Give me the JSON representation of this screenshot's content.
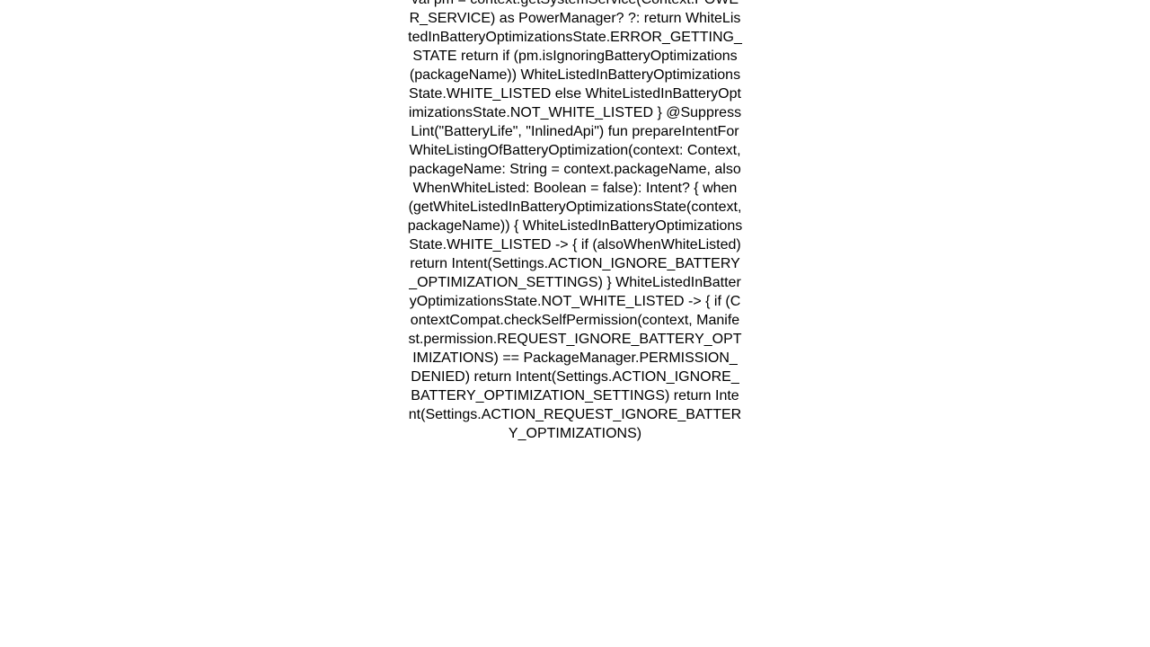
{
  "page": {
    "background_color": "#ffffff",
    "text_color": "#000000",
    "alignment": "center",
    "clipped_top": true,
    "clipped_bottom": true
  },
  "code": {
    "language": "Kotlin",
    "text": "val pm = context.getSystemService(Context.POWER_SERVICE) as PowerManager?         ?: return WhiteListedInBatteryOptimizationsState.ERROR_GETTING_STATE         return if (pm.isIgnoringBatteryOptimizations(packageName))             WhiteListedInBatteryOptimizationsState.WHITE_LISTED         else WhiteListedInBatteryOptimizationsState.NOT_WHITE_LISTED     }     @SuppressLint(\"BatteryLife\", \"InlinedApi\")     fun prepareIntentForWhiteListingOfBatteryOptimization(context: Context, packageName: String = context.packageName, alsoWhenWhiteListed: Boolean = false): Intent? {         when (getWhiteListedInBatteryOptimizationsState(context, packageName)) {             WhiteListedInBatteryOptimizationsState.WHITE_LISTED -> {                 if (alsoWhenWhiteListed)                     return Intent(Settings.ACTION_IGNORE_BATTERY_OPTIMIZATION_SETTINGS)             }             WhiteListedInBatteryOptimizationsState.NOT_WHITE_LISTED -> {                 if (ContextCompat.checkSelfPermission(context, Manifest.permission.REQUEST_IGNORE_BATTERY_OPTIMIZATIONS) == PackageManager.PERMISSION_DENIED)                     return Intent(Settings.ACTION_IGNORE_BATTERY_OPTIMIZATION_SETTINGS)                 return Intent(Settings.ACTION_REQUEST_IGNORE_BATTERY_OPTIMIZATIONS)",
    "visible_lines": [
      "val pm = context.getSystemService(Contex",
      "t.POWER_SERVICE) as PowerManager?",
      "?: return WhiteListedInBatteryOptimizati",
      "onsState.ERROR_GETTING_STATE",
      "return if (pm.isIgnoringBatteryOptimizat",
      "ions(packageName))          WhiteList",
      "edInBatteryOptimizationsState.WHITE_LIST",
      "ED       else WhiteListedInBatteryOpti",
      "mizationsState.NOT_WHITE_LISTED    }",
      "@SuppressLint(\"BatteryLife\",",
      "\"InlinedApi\")     fun prepareIntentForWh",
      "iteListingOfBatteryOptimization(context:",
      "Context, packageName: String =",
      "context.packageName,",
      "alsoWhenWhiteListed: Boolean = false):",
      "Intent? {        when (getWhiteListedIn",
      "BatteryOptimizationsState(context,",
      "packageName)) {           WhiteListedI",
      "nBatteryOptimizationsState.WHITE_LISTED",
      "-> {                 if",
      "(alsoWhenWhiteListed)",
      "return Intent(Settings.ACTION_IGNORE_BAT",
      "TERY_OPTIMIZATION_SETTINGS)",
      "}            WhiteListedInBatteryOptim",
      "izationsState.NOT_WHITE_LISTED -> {",
      "if (ContextCompat.checkSelfPermission(co",
      "ntext, Manifest.permission.REQUEST_IGNOR",
      "E_BATTERY_OPTIMIZATIONS) ==",
      "PackageManager.PERMISSION_DENIED)",
      "return Intent(Settings.ACTION_IGNORE_BAT",
      "TERY_OPTIMIZATION_SETTINGS)",
      "return Intent(Settings.ACTION_REQUEST_IG",
      "NORE_BATTERY_OPTIMIZATIONS)"
    ]
  }
}
